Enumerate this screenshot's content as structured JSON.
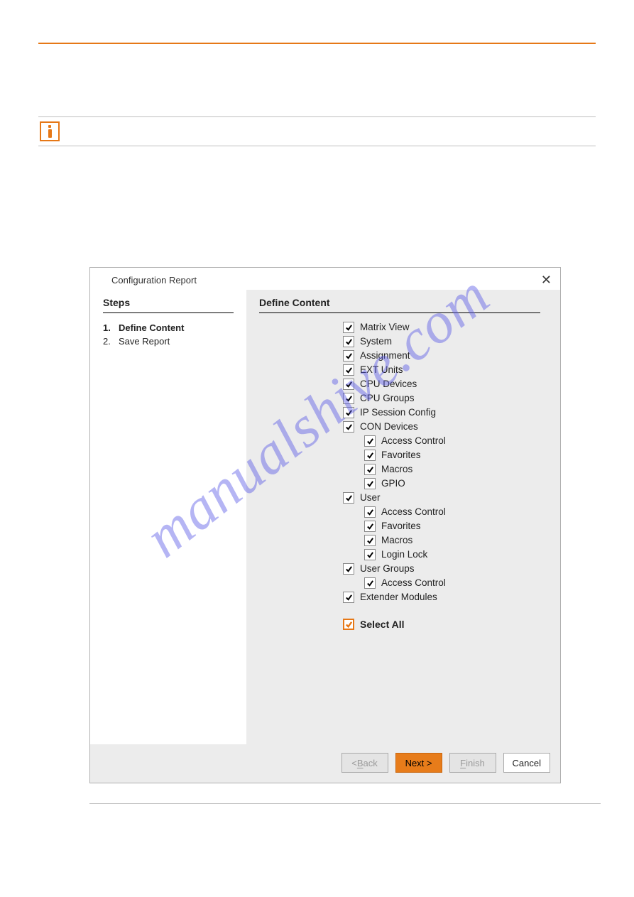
{
  "watermark": "manualshive.com",
  "dialog": {
    "title": "Configuration Report",
    "close_glyph": "✕",
    "steps_heading": "Steps",
    "define_heading": "Define Content",
    "steps": [
      {
        "num": "1.",
        "label": "Define Content",
        "current": true
      },
      {
        "num": "2.",
        "label": "Save Report",
        "current": false
      }
    ],
    "items": [
      {
        "label": "Matrix View",
        "checked": true,
        "level": 0
      },
      {
        "label": "System",
        "checked": true,
        "level": 0
      },
      {
        "label": "Assignment",
        "checked": true,
        "level": 0
      },
      {
        "label": "EXT Units",
        "checked": true,
        "level": 0
      },
      {
        "label": "CPU Devices",
        "checked": true,
        "level": 0
      },
      {
        "label": "CPU Groups",
        "checked": true,
        "level": 0
      },
      {
        "label": "IP Session Config",
        "checked": true,
        "level": 0
      },
      {
        "label": "CON Devices",
        "checked": true,
        "level": 0
      },
      {
        "label": "Access Control",
        "checked": true,
        "level": 1
      },
      {
        "label": "Favorites",
        "checked": true,
        "level": 1
      },
      {
        "label": "Macros",
        "checked": true,
        "level": 1
      },
      {
        "label": "GPIO",
        "checked": true,
        "level": 1
      },
      {
        "label": "User",
        "checked": true,
        "level": 0
      },
      {
        "label": "Access Control",
        "checked": true,
        "level": 1
      },
      {
        "label": "Favorites",
        "checked": true,
        "level": 1
      },
      {
        "label": "Macros",
        "checked": true,
        "level": 1
      },
      {
        "label": "Login Lock",
        "checked": true,
        "level": 1
      },
      {
        "label": "User Groups",
        "checked": true,
        "level": 0
      },
      {
        "label": "Access Control",
        "checked": true,
        "level": 1
      },
      {
        "label": "Extender Modules",
        "checked": true,
        "level": 0
      }
    ],
    "select_all": {
      "label": "Select All",
      "checked": true
    },
    "buttons": {
      "back_pre": "< ",
      "back_mn": "B",
      "back_post": "ack",
      "next": "Next >",
      "finish_mn": "F",
      "finish_post": "inish",
      "cancel": "Cancel"
    }
  }
}
